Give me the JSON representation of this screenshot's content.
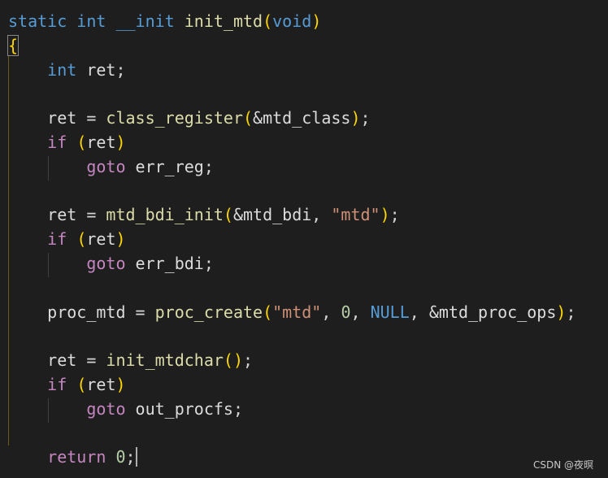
{
  "window": {
    "background": "#1e1e1e"
  },
  "code_lines": [
    [
      [
        "kw",
        "static"
      ],
      [
        "punct",
        " "
      ],
      [
        "kw",
        "int"
      ],
      [
        "punct",
        " "
      ],
      [
        "kw",
        "__init"
      ],
      [
        "punct",
        " "
      ],
      [
        "fn",
        "init_mtd"
      ],
      [
        "paren1",
        "("
      ],
      [
        "kw",
        "void"
      ],
      [
        "paren1",
        ")"
      ]
    ],
    [
      [
        "brace",
        "{"
      ]
    ],
    [
      [
        "punct",
        "    "
      ],
      [
        "kw",
        "int"
      ],
      [
        "punct",
        " "
      ],
      [
        "id",
        "ret"
      ],
      [
        "punct",
        ";"
      ]
    ],
    [],
    [
      [
        "punct",
        "    "
      ],
      [
        "id",
        "ret"
      ],
      [
        "punct",
        " = "
      ],
      [
        "fn",
        "class_register"
      ],
      [
        "paren1",
        "("
      ],
      [
        "id",
        "&mtd_class"
      ],
      [
        "paren1",
        ")"
      ],
      [
        "punct",
        ";"
      ]
    ],
    [
      [
        "punct",
        "    "
      ],
      [
        "ctrl",
        "if"
      ],
      [
        "punct",
        " "
      ],
      [
        "paren1",
        "("
      ],
      [
        "id",
        "ret"
      ],
      [
        "paren1",
        ")"
      ]
    ],
    [
      [
        "punct",
        "        "
      ],
      [
        "ctrl",
        "goto"
      ],
      [
        "punct",
        " "
      ],
      [
        "id",
        "err_reg"
      ],
      [
        "punct",
        ";"
      ]
    ],
    [],
    [
      [
        "punct",
        "    "
      ],
      [
        "id",
        "ret"
      ],
      [
        "punct",
        " = "
      ],
      [
        "fn",
        "mtd_bdi_init"
      ],
      [
        "paren1",
        "("
      ],
      [
        "id",
        "&mtd_bdi"
      ],
      [
        "punct",
        ", "
      ],
      [
        "str",
        "\"mtd\""
      ],
      [
        "paren1",
        ")"
      ],
      [
        "punct",
        ";"
      ]
    ],
    [
      [
        "punct",
        "    "
      ],
      [
        "ctrl",
        "if"
      ],
      [
        "punct",
        " "
      ],
      [
        "paren1",
        "("
      ],
      [
        "id",
        "ret"
      ],
      [
        "paren1",
        ")"
      ]
    ],
    [
      [
        "punct",
        "        "
      ],
      [
        "ctrl",
        "goto"
      ],
      [
        "punct",
        " "
      ],
      [
        "id",
        "err_bdi"
      ],
      [
        "punct",
        ";"
      ]
    ],
    [],
    [
      [
        "punct",
        "    "
      ],
      [
        "id",
        "proc_mtd"
      ],
      [
        "punct",
        " = "
      ],
      [
        "fn",
        "proc_create"
      ],
      [
        "paren1",
        "("
      ],
      [
        "str",
        "\"mtd\""
      ],
      [
        "punct",
        ", "
      ],
      [
        "num",
        "0"
      ],
      [
        "punct",
        ", "
      ],
      [
        "const",
        "NULL"
      ],
      [
        "punct",
        ", "
      ],
      [
        "id",
        "&mtd_proc_ops"
      ],
      [
        "paren1",
        ")"
      ],
      [
        "punct",
        ";"
      ]
    ],
    [],
    [
      [
        "punct",
        "    "
      ],
      [
        "id",
        "ret"
      ],
      [
        "punct",
        " = "
      ],
      [
        "fn",
        "init_mtdchar"
      ],
      [
        "paren1",
        "("
      ],
      [
        "paren1",
        ")"
      ],
      [
        "punct",
        ";"
      ]
    ],
    [
      [
        "punct",
        "    "
      ],
      [
        "ctrl",
        "if"
      ],
      [
        "punct",
        " "
      ],
      [
        "paren1",
        "("
      ],
      [
        "id",
        "ret"
      ],
      [
        "paren1",
        ")"
      ]
    ],
    [
      [
        "punct",
        "        "
      ],
      [
        "ctrl",
        "goto"
      ],
      [
        "punct",
        " "
      ],
      [
        "id",
        "out_procfs"
      ],
      [
        "punct",
        ";"
      ]
    ],
    [],
    [
      [
        "punct",
        "    "
      ],
      [
        "ctrl",
        "return"
      ],
      [
        "punct",
        " "
      ],
      [
        "num",
        "0"
      ],
      [
        "punct",
        ";"
      ],
      [
        "cursor",
        ""
      ]
    ]
  ],
  "watermark": "CSDN @夜暝",
  "colors": {
    "keyword": "#569cd6",
    "control": "#c586c0",
    "function": "#dcdcaa",
    "identifier": "#dcdcdc",
    "string": "#ce9178",
    "number": "#b5cea8",
    "brace": "#ffd700"
  }
}
